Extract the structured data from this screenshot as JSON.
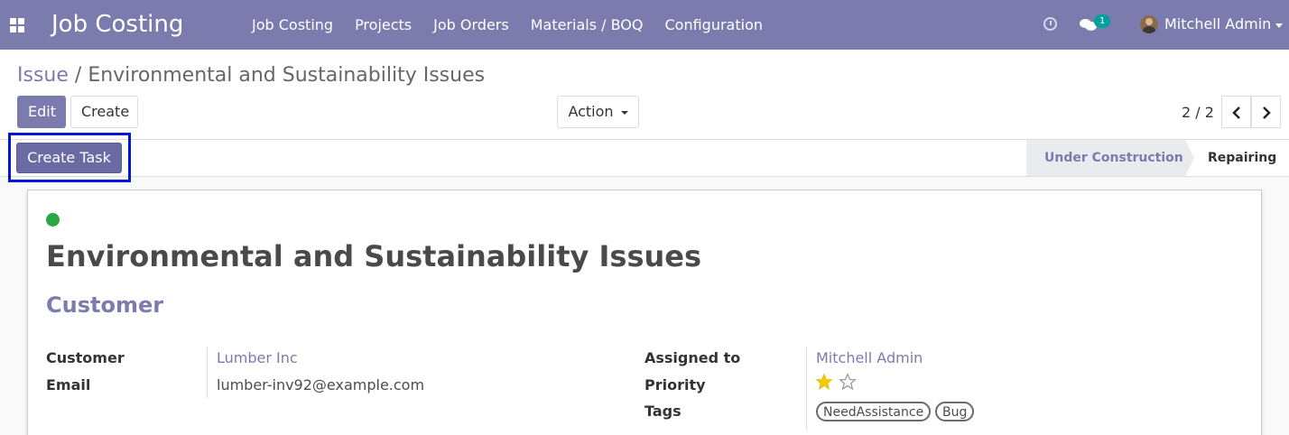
{
  "navbar": {
    "app_title": "Job Costing",
    "menu": [
      "Job Costing",
      "Projects",
      "Job Orders",
      "Materials / BOQ",
      "Configuration"
    ],
    "messages_count": "1",
    "user_name": "Mitchell Admin",
    "color": "#7c7bad"
  },
  "control_panel": {
    "breadcrumb_parent": "Issue",
    "breadcrumb_sep": "/",
    "breadcrumb_current": "Environmental and Sustainability Issues",
    "edit_label": "Edit",
    "create_label": "Create",
    "action_label": "Action",
    "pager": "2 / 2"
  },
  "statusbar": {
    "create_task_label": "Create Task",
    "stages": [
      "Under Construction",
      "Repairing"
    ],
    "current_stage": "Repairing"
  },
  "form": {
    "kanban_state_color": "#28a745",
    "title": "Environmental and Sustainability Issues",
    "group_title": "Customer",
    "left": [
      {
        "label": "Customer",
        "value": "Lumber Inc"
      },
      {
        "label": "Email",
        "value": "lumber-inv92@example.com"
      }
    ],
    "right_labels": {
      "assigned": "Assigned to",
      "priority": "Priority",
      "tags": "Tags"
    },
    "assigned_to": "Mitchell Admin",
    "priority": {
      "value": 1,
      "max": 2
    },
    "tags": [
      "NeedAssistance",
      "Bug"
    ]
  }
}
